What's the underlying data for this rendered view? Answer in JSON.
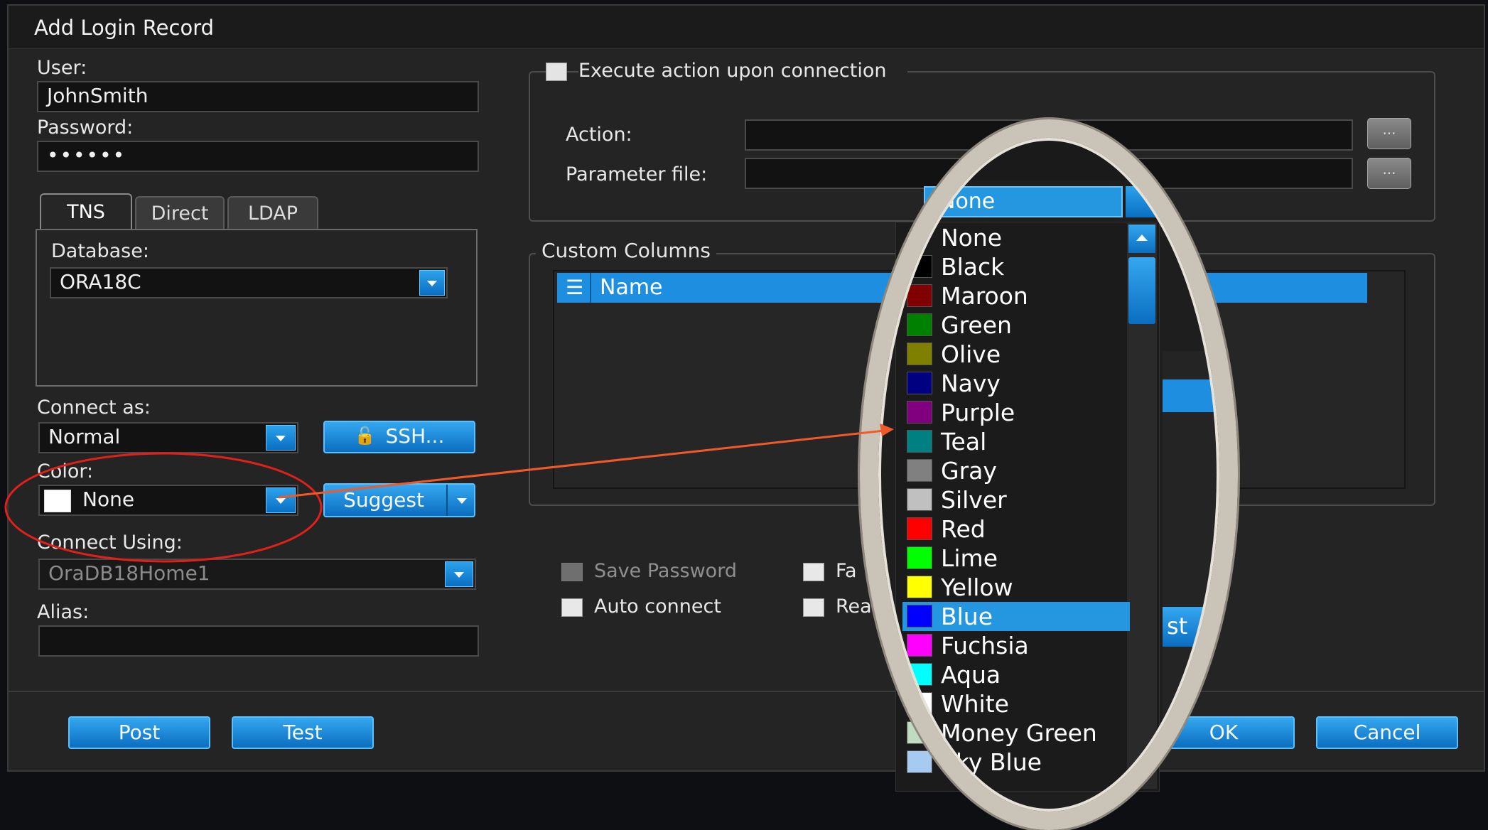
{
  "dialog": {
    "title": "Add Login Record"
  },
  "left": {
    "user_label": "User:",
    "user_value": "JohnSmith",
    "password_label": "Password:",
    "password_value": "••••••",
    "tabs": [
      "TNS",
      "Direct",
      "LDAP"
    ],
    "database_label": "Database:",
    "database_value": "ORA18C",
    "connect_as_label": "Connect as:",
    "connect_as_value": "Normal",
    "ssh_button": "SSH...",
    "color_label": "Color:",
    "color_value": "None",
    "suggest_button": "Suggest",
    "connect_using_label": "Connect Using:",
    "connect_using_value": "OraDB18Home1",
    "alias_label": "Alias:",
    "alias_value": ""
  },
  "right": {
    "execute_action_label": "Execute action upon connection",
    "action_label": "Action:",
    "parameter_file_label": "Parameter file:",
    "ellipsis": "...",
    "custom_columns_title": "Custom Columns",
    "custom_columns_header": "Name",
    "partial_button_text": "st",
    "save_password_label": "Save Password",
    "auto_connect_label": "Auto connect",
    "fav_partial": "Fa",
    "rea_partial": "Rea"
  },
  "footer": {
    "post": "Post",
    "test": "Test",
    "ok": "OK",
    "cancel": "Cancel"
  },
  "color_dropdown": {
    "selected_top": "None",
    "items": [
      {
        "name": "None",
        "color": ""
      },
      {
        "name": "Black",
        "color": "#000000"
      },
      {
        "name": "Maroon",
        "color": "#800000"
      },
      {
        "name": "Green",
        "color": "#008000"
      },
      {
        "name": "Olive",
        "color": "#808000"
      },
      {
        "name": "Navy",
        "color": "#000080"
      },
      {
        "name": "Purple",
        "color": "#800080"
      },
      {
        "name": "Teal",
        "color": "#008080"
      },
      {
        "name": "Gray",
        "color": "#808080"
      },
      {
        "name": "Silver",
        "color": "#c0c0c0"
      },
      {
        "name": "Red",
        "color": "#ff0000"
      },
      {
        "name": "Lime",
        "color": "#00ff00"
      },
      {
        "name": "Yellow",
        "color": "#ffff00"
      },
      {
        "name": "Blue",
        "color": "#0000ff"
      },
      {
        "name": "Fuchsia",
        "color": "#ff00ff"
      },
      {
        "name": "Aqua",
        "color": "#00ffff"
      },
      {
        "name": "White",
        "color": "#ffffff"
      },
      {
        "name": "Money Green",
        "color": "#c0dcc0"
      },
      {
        "name": "Sky Blue",
        "color": "#a6caf0"
      }
    ],
    "highlighted_index": 13
  },
  "colors": {
    "accent": "#1e8fe0",
    "annotation_red": "#e0201a",
    "arrow": "#f05a28"
  }
}
